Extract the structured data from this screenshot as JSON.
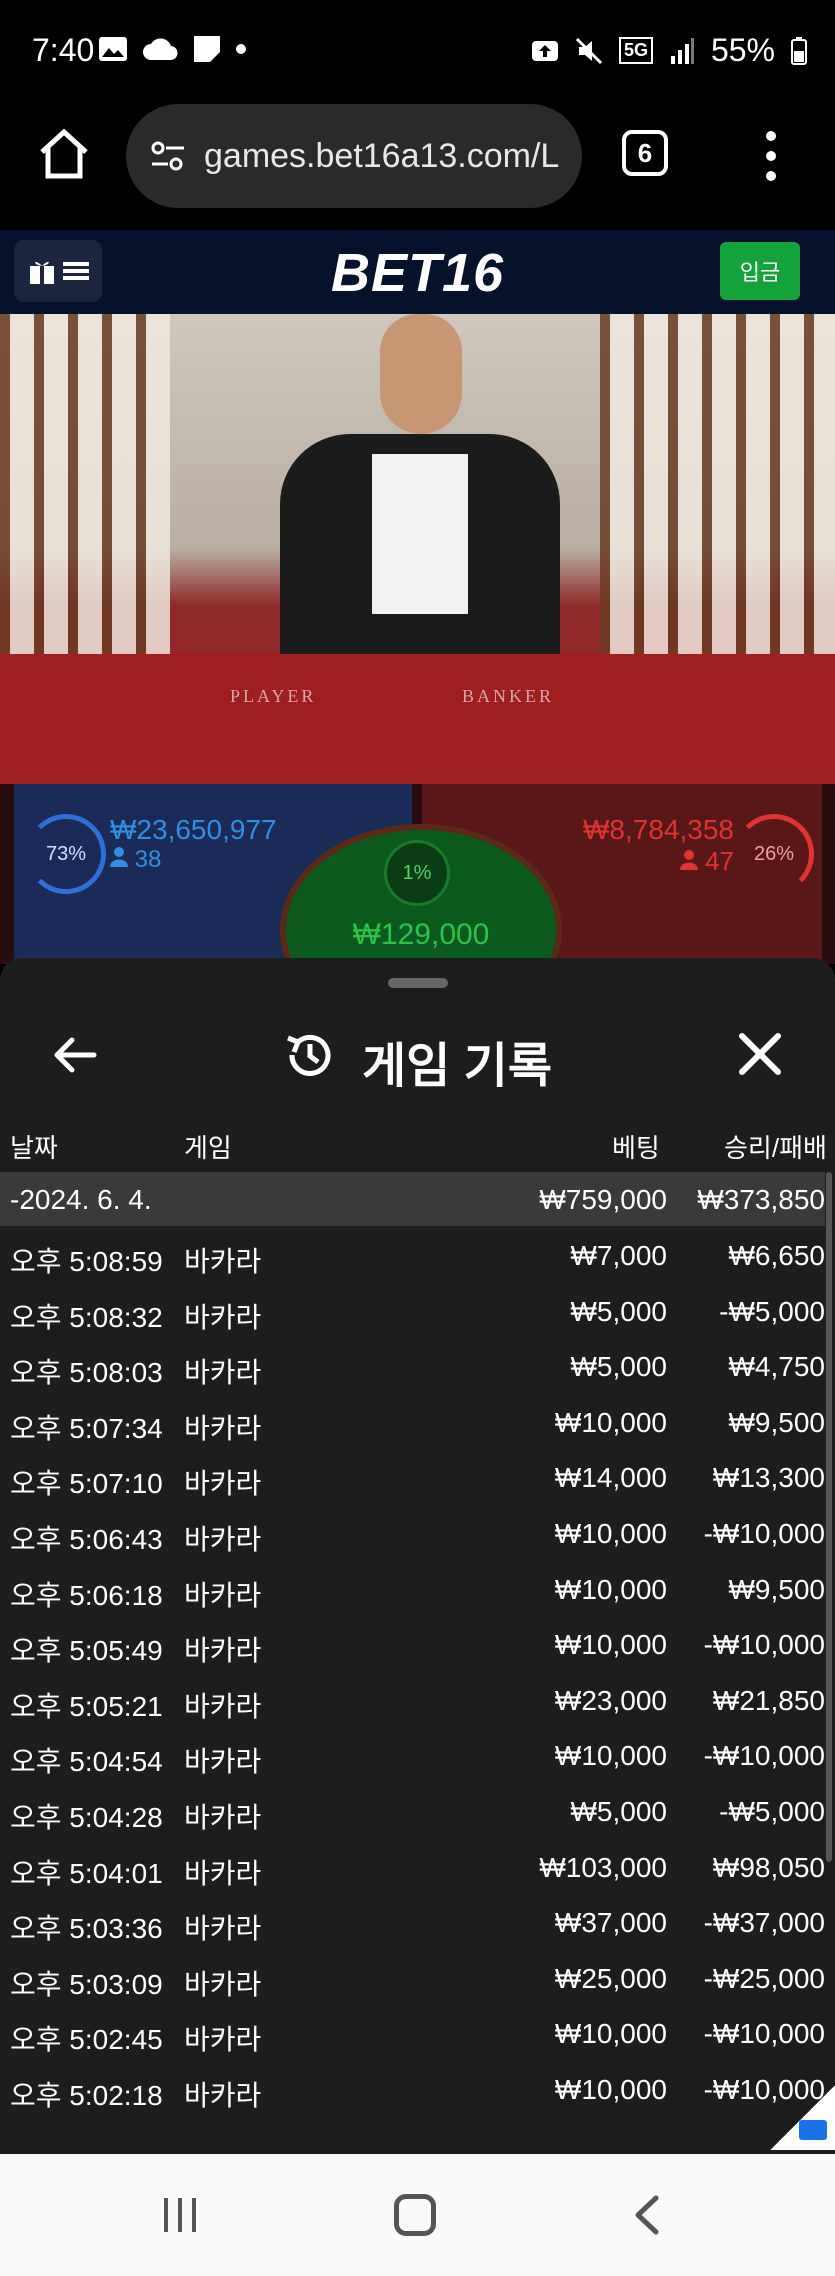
{
  "status_bar": {
    "time": "7:40",
    "battery": "55%",
    "network": "5G"
  },
  "browser": {
    "url": "games.bet16a13.com/L",
    "tab_count": "6"
  },
  "site": {
    "logo": "BET16",
    "deposit_label": "입금"
  },
  "video": {
    "player_label": "PLAYER",
    "banker_label": "BANKER"
  },
  "bets": {
    "player_pct": "73%",
    "player_amount": "₩23,650,977",
    "player_count": "38",
    "banker_pct": "26%",
    "banker_amount": "₩8,784,358",
    "banker_count": "47",
    "tie_pct": "1%",
    "tie_amount": "₩129,000"
  },
  "sheet": {
    "title": "게임 기록",
    "columns": {
      "date": "날짜",
      "game": "게임",
      "bet": "베팅",
      "result": "승리/패배"
    },
    "summary": {
      "date": "-2024. 6. 4.",
      "bet": "₩759,000",
      "result": "₩373,850"
    },
    "rows": [
      {
        "time": "오후 5:08:59",
        "game": "바카라",
        "bet": "₩7,000",
        "result": "₩6,650"
      },
      {
        "time": "오후 5:08:32",
        "game": "바카라",
        "bet": "₩5,000",
        "result": "-₩5,000"
      },
      {
        "time": "오후 5:08:03",
        "game": "바카라",
        "bet": "₩5,000",
        "result": "₩4,750"
      },
      {
        "time": "오후 5:07:34",
        "game": "바카라",
        "bet": "₩10,000",
        "result": "₩9,500"
      },
      {
        "time": "오후 5:07:10",
        "game": "바카라",
        "bet": "₩14,000",
        "result": "₩13,300"
      },
      {
        "time": "오후 5:06:43",
        "game": "바카라",
        "bet": "₩10,000",
        "result": "-₩10,000"
      },
      {
        "time": "오후 5:06:18",
        "game": "바카라",
        "bet": "₩10,000",
        "result": "₩9,500"
      },
      {
        "time": "오후 5:05:49",
        "game": "바카라",
        "bet": "₩10,000",
        "result": "-₩10,000"
      },
      {
        "time": "오후 5:05:21",
        "game": "바카라",
        "bet": "₩23,000",
        "result": "₩21,850"
      },
      {
        "time": "오후 5:04:54",
        "game": "바카라",
        "bet": "₩10,000",
        "result": "-₩10,000"
      },
      {
        "time": "오후 5:04:28",
        "game": "바카라",
        "bet": "₩5,000",
        "result": "-₩5,000"
      },
      {
        "time": "오후 5:04:01",
        "game": "바카라",
        "bet": "₩103,000",
        "result": "₩98,050"
      },
      {
        "time": "오후 5:03:36",
        "game": "바카라",
        "bet": "₩37,000",
        "result": "-₩37,000"
      },
      {
        "time": "오후 5:03:09",
        "game": "바카라",
        "bet": "₩25,000",
        "result": "-₩25,000"
      },
      {
        "time": "오후 5:02:45",
        "game": "바카라",
        "bet": "₩10,000",
        "result": "-₩10,000"
      },
      {
        "time": "오후 5:02:18",
        "game": "바카라",
        "bet": "₩10,000",
        "result": "-₩10,000"
      }
    ]
  }
}
